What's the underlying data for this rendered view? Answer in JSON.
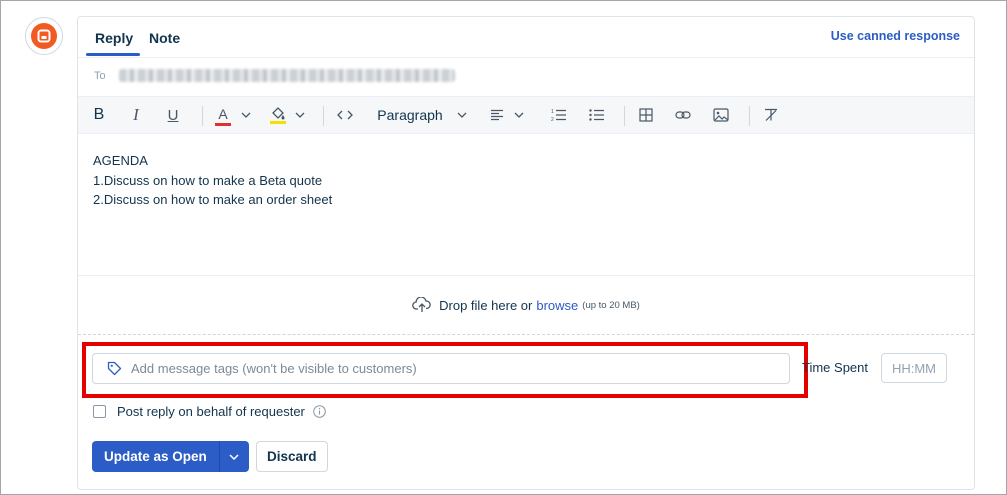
{
  "tabs": {
    "reply": "Reply",
    "note": "Note",
    "active": "Reply"
  },
  "canned_response_label": "Use canned response",
  "to_field": {
    "label": "To"
  },
  "toolbar": {
    "bold_label": "B",
    "italic_label": "I",
    "underline_label": "U",
    "text_color_label": "A",
    "text_color": "#e03131",
    "highlight_color": "#f7e000",
    "paragraph_label": "Paragraph"
  },
  "editor": {
    "lines": [
      "AGENDA",
      "1.Discuss on how to make a Beta quote",
      "2.Discuss on how to make an order sheet"
    ]
  },
  "dropzone": {
    "text": "Drop file here or",
    "browse_label": "browse",
    "limit": "(up to 20 MB)"
  },
  "tags": {
    "placeholder": "Add message tags (won't be visible to customers)"
  },
  "time_spent": {
    "label": "Time Spent",
    "placeholder": "HH:MM"
  },
  "behalf": {
    "label": "Post reply on behalf of requester",
    "checked": false
  },
  "actions": {
    "primary_label": "Update as Open",
    "discard_label": "Discard"
  },
  "colors": {
    "accent": "#2c5cc5",
    "highlight_box": "#e50000",
    "brand": "#f15a22"
  }
}
